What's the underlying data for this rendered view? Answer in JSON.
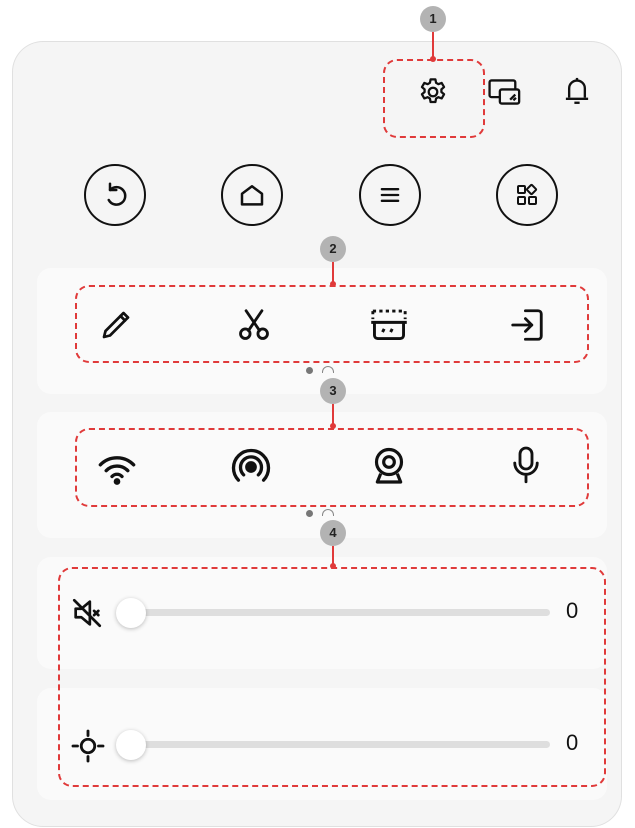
{
  "callouts": [
    "1",
    "2",
    "3",
    "4"
  ],
  "header_icons": [
    "settings-icon",
    "screen-cast-icon",
    "bell-icon"
  ],
  "nav_buttons": [
    "back-icon",
    "home-icon",
    "menu-icon",
    "apps-icon"
  ],
  "tools": [
    "pen-icon",
    "scissors-icon",
    "screenshot-icon",
    "exit-icon"
  ],
  "connectivity": [
    "wifi-icon",
    "hotspot-icon",
    "webcam-icon",
    "microphone-icon"
  ],
  "sliders": {
    "volume": {
      "icon": "muted-speaker-icon",
      "value": "0",
      "level": 0
    },
    "brightness": {
      "icon": "brightness-icon",
      "value": "0",
      "level": 0
    }
  },
  "colors": {
    "accent": "#e03a3a",
    "callout_bg": "#b3b3b3",
    "panel": "#f5f5f5"
  }
}
